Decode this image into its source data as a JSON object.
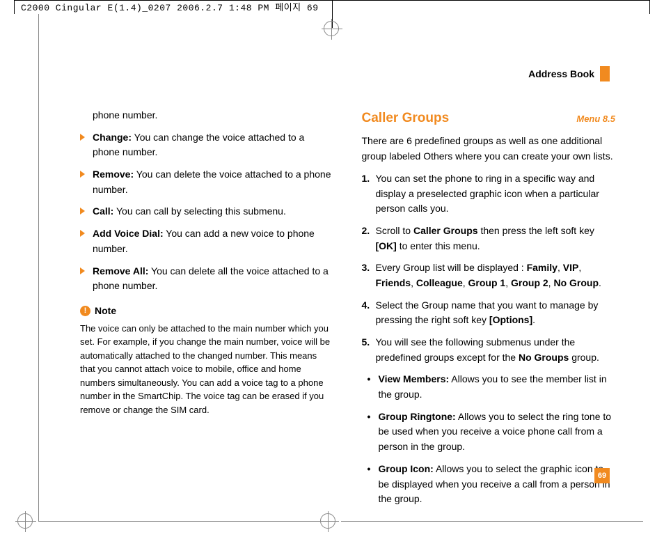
{
  "header": "C2000 Cingular E(1.4)_0207  2006.2.7 1:48 PM 페이지 69",
  "top_label": "Address Book",
  "page_number": "69",
  "left": {
    "cont": "phone number.",
    "items": [
      {
        "label": "Change:",
        "text": " You can change the voice attached to a phone number."
      },
      {
        "label": "Remove:",
        "text": " You can delete the voice attached to a phone number."
      },
      {
        "label": "Call:",
        "text": " You can call by selecting this submenu."
      },
      {
        "label": "Add Voice Dial:",
        "text": " You can add a new voice to phone number."
      },
      {
        "label": "Remove All:",
        "text": " You can delete all the voice attached to a phone number."
      }
    ],
    "note_label": "Note",
    "note_body": "The voice can only be attached to the main number which you set. For example, if you change the main number, voice will be automatically attached to the changed number. This means that you cannot attach voice to mobile, office and home numbers simultaneously. You can add a voice tag to a phone number in the SmartChip. The voice tag can be erased if you remove or change the SIM card."
  },
  "right": {
    "title": "Caller Groups",
    "menu": "Menu 8.5",
    "intro": "There are 6 predefined groups as well as one additional group labeled Others where you can create your own lists.",
    "steps": {
      "s1": "You can set the phone to ring in a specific way and display a preselected graphic icon when a particular person calls you.",
      "s2a": "Scroll to ",
      "s2b": "Caller Groups",
      "s2c": " then press the left soft key ",
      "s2d": "[OK]",
      "s2e": " to enter this menu.",
      "s3a": "Every Group list will be displayed : ",
      "s3b": "Family",
      "s3c": "VIP",
      "s3d": "Friends",
      "s3e": "Colleague",
      "s3f": "Group 1",
      "s3g": "Group 2",
      "s3h": "No Group",
      "s4a": "Select the Group name that you want to manage by pressing the right soft key ",
      "s4b": "[Options]",
      "s5a": "You will see the following submenus under the predefined groups except for the ",
      "s5b": "No Groups",
      "s5c": " group."
    },
    "subs": {
      "a_label": "View Members:",
      "a_text": " Allows you to see the member list in the group.",
      "b_label": "Group Ringtone:",
      "b_text": " Allows you to select the ring tone to be used when you receive a voice phone call from a person in the group.",
      "c_label": "Group Icon:",
      "c_text": " Allows you to select the graphic icon to be displayed when you receive a call from a person in the group."
    }
  }
}
